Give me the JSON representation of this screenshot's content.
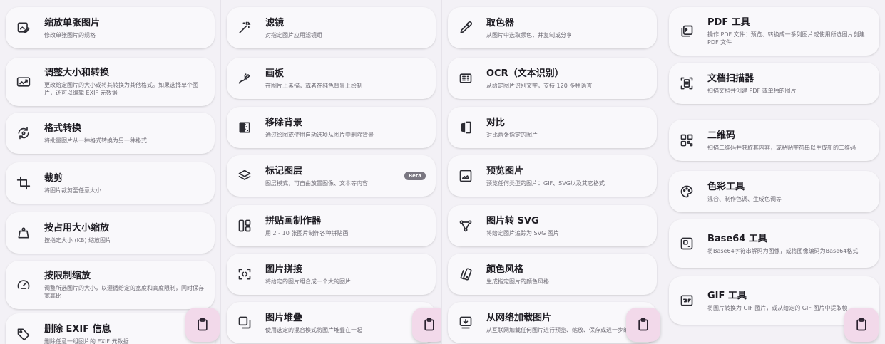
{
  "columns": [
    {
      "cards": [
        {
          "title": "缩放单张图片",
          "desc": "修改单张图片的规格",
          "icon": "image-edit-icon"
        },
        {
          "title": "调整大小和转换",
          "desc": "更改给定图片的大小或将其转换为其他格式。如果选择单个图片，还可以编辑 EXIF 元数据",
          "icon": "photo-resize-icon"
        },
        {
          "title": "格式转换",
          "desc": "将批量图片从一种格式转换为另一种格式",
          "icon": "format-convert-icon"
        },
        {
          "title": "裁剪",
          "desc": "将图片裁剪至任意大小",
          "icon": "crop-icon"
        },
        {
          "title": "按占用大小缩放",
          "desc": "按指定大小 (KB) 缩放图片",
          "icon": "weight-icon"
        },
        {
          "title": "按限制缩放",
          "desc": "调整所选图片的大小，以遵循给定的宽度和高度限制，同时保存宽高比",
          "icon": "limit-gauge-icon"
        },
        {
          "title": "删除 EXIF 信息",
          "desc": "删除任意一组图片的 EXIF 元数据",
          "icon": "tag-remove-icon"
        }
      ]
    },
    {
      "cards": [
        {
          "title": "滤镜",
          "desc": "对指定图片应用滤镜组",
          "icon": "magic-wand-icon"
        },
        {
          "title": "画板",
          "desc": "在图片上素描，或者在纯色背景上绘制",
          "icon": "draw-icon"
        },
        {
          "title": "移除背景",
          "desc": "通过绘图或使用自动选项从图片中删除背景",
          "icon": "background-remove-icon"
        },
        {
          "title": "标记图层",
          "desc": "图层模式，可自由放置图像、文本等内容",
          "icon": "layers-icon",
          "badge": "Beta"
        },
        {
          "title": "拼贴画制作器",
          "desc": "用 2 - 10 张图片制作各种拼贴画",
          "icon": "collage-icon"
        },
        {
          "title": "图片拼接",
          "desc": "将给定的图片组合成一个大的图片",
          "icon": "stitch-icon"
        },
        {
          "title": "图片堆叠",
          "desc": "使用选定的混合模式将图片堆叠在一起",
          "icon": "stack-icon"
        }
      ]
    },
    {
      "cards": [
        {
          "title": "取色器",
          "desc": "从图片中选取颜色，并复制或分享",
          "icon": "eyedropper-icon"
        },
        {
          "title": "OCR（文本识别）",
          "desc": "从给定图片识别文字，支持 120 多种语言",
          "icon": "ocr-icon"
        },
        {
          "title": "对比",
          "desc": "对比两张指定的图片",
          "icon": "compare-icon"
        },
        {
          "title": "预览图片",
          "desc": "预览任何类型的图片：GIF、SVG以及其它格式",
          "icon": "image-preview-icon"
        },
        {
          "title": "图片转 SVG",
          "desc": "将给定图片追踪为 SVG 图片",
          "icon": "vector-icon"
        },
        {
          "title": "颜色风格",
          "desc": "生成指定图片的颜色风格",
          "icon": "palette-swatch-icon"
        },
        {
          "title": "从网络加载图片",
          "desc": "从互联网加载任何图片进行预览、缩放、保存或进一步编辑",
          "icon": "web-load-icon"
        }
      ]
    },
    {
      "cards": [
        {
          "title": "PDF 工具",
          "desc": "操作 PDF 文件：预览、转换成一系列图片或使用所选图片创建 PDF 文件",
          "icon": "pdf-icon"
        },
        {
          "title": "文档扫描器",
          "desc": "扫描文档并创建 PDF 或单独的图片",
          "icon": "document-scan-icon"
        },
        {
          "title": "二维码",
          "desc": "扫描二维码并获取其内容，或粘贴字符串以生成新的二维码",
          "icon": "qr-code-icon"
        },
        {
          "title": "色彩工具",
          "desc": "混合、制作色调、生成色调等",
          "icon": "color-palette-icon"
        },
        {
          "title": "Base64 工具",
          "desc": "将Base64字符串解码为图像，或将图像编码为Base64格式",
          "icon": "base64-icon"
        },
        {
          "title": "GIF 工具",
          "desc": "将图片转换为 GIF 图片，或从给定的 GIF 图片中提取帧",
          "icon": "gif-icon"
        }
      ]
    }
  ],
  "fab": {
    "icon": "clipboard-icon"
  }
}
